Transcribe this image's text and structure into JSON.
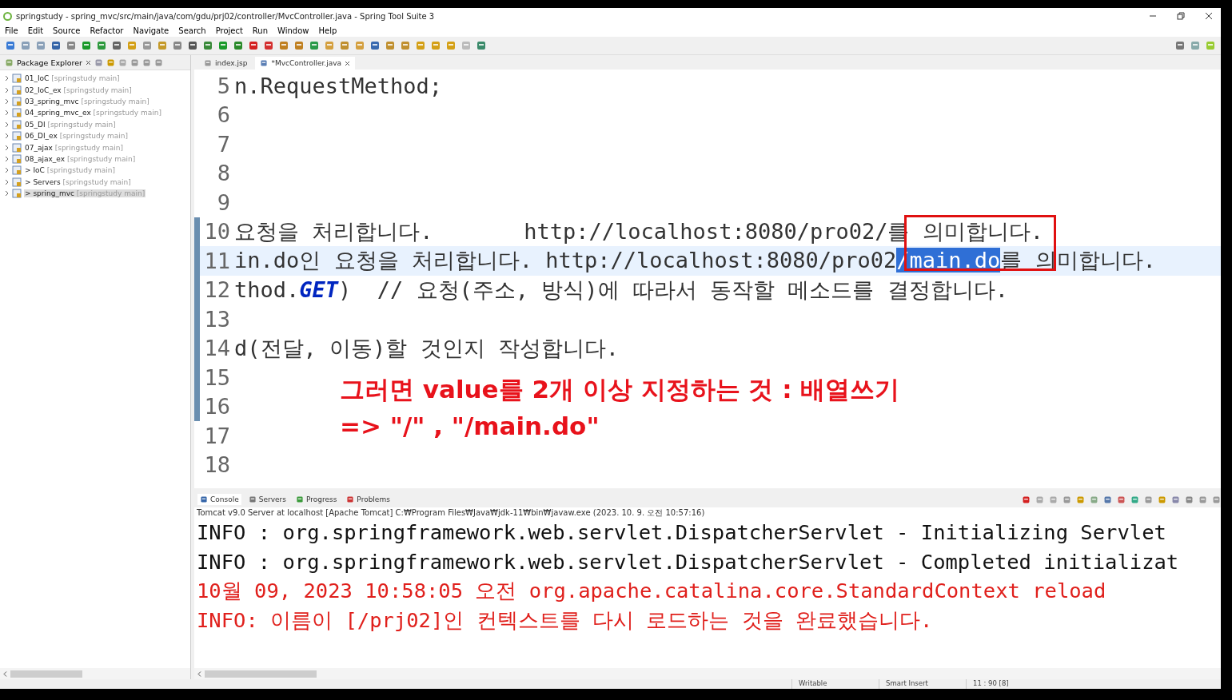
{
  "window": {
    "title": "springstudy - spring_mvc/src/main/java/com/gdu/prj02/controller/MvcController.java - Spring Tool Suite 3"
  },
  "menu": [
    "File",
    "Edit",
    "Source",
    "Refactor",
    "Navigate",
    "Search",
    "Project",
    "Run",
    "Window",
    "Help"
  ],
  "package_explorer": {
    "title": "Package Explorer",
    "items": [
      {
        "name": "01_IoC",
        "location": "[springstudy main]",
        "marker": "",
        "selected": false
      },
      {
        "name": "02_IoC_ex",
        "location": "[springstudy main]",
        "marker": "",
        "selected": false
      },
      {
        "name": "03_spring_mvc",
        "location": "[springstudy main]",
        "marker": "",
        "selected": false
      },
      {
        "name": "04_spring_mvc_ex",
        "location": "[springstudy main]",
        "marker": "",
        "selected": false
      },
      {
        "name": "05_DI",
        "location": "[springstudy main]",
        "marker": "",
        "selected": false
      },
      {
        "name": "06_DI_ex",
        "location": "[springstudy main]",
        "marker": "",
        "selected": false
      },
      {
        "name": "07_ajax",
        "location": "[springstudy main]",
        "marker": "",
        "selected": false
      },
      {
        "name": "08_ajax_ex",
        "location": "[springstudy main]",
        "marker": "",
        "selected": false
      },
      {
        "name": "IoC",
        "location": "[springstudy main]",
        "marker": ">",
        "selected": false
      },
      {
        "name": "Servers",
        "location": "[springstudy main]",
        "marker": ">",
        "selected": false
      },
      {
        "name": "spring_mvc",
        "location": "[springstudy main]",
        "marker": ">",
        "selected": true
      }
    ]
  },
  "editor": {
    "tabs": [
      {
        "label": "index.jsp",
        "selected": false
      },
      {
        "label": "*MvcController.java",
        "selected": true
      }
    ],
    "lines": [
      {
        "number": "5",
        "current": false,
        "changed": false,
        "segments": [
          {
            "text": "n.RequestMethod;",
            "kind": "plain"
          }
        ]
      },
      {
        "number": "6",
        "current": false,
        "changed": false
      },
      {
        "number": "7",
        "current": false,
        "changed": false
      },
      {
        "number": "8",
        "current": false,
        "changed": false
      },
      {
        "number": "9",
        "current": false,
        "changed": false
      },
      {
        "number": "10",
        "current": false,
        "changed": true,
        "segments": [
          {
            "text": "요청을 처리합니다.       http://localhost:8080/pro02/를 의미합니다.",
            "kind": "plain"
          }
        ]
      },
      {
        "number": "11",
        "current": true,
        "changed": true,
        "segments": [
          {
            "text": "in.do인 요청을 처리합니다. http://localhost:8080/pro02",
            "kind": "plain"
          },
          {
            "text": "/main.do",
            "kind": "selected"
          },
          {
            "text": "를 의미합니다.",
            "kind": "plain"
          }
        ]
      },
      {
        "number": "12",
        "current": false,
        "changed": true,
        "segments": [
          {
            "text": "thod.",
            "kind": "plain"
          },
          {
            "text": "GET",
            "kind": "constant"
          },
          {
            "text": ")  // 요청(주소, 방식)에 따라서 동작할 메소드를 결정합니다.",
            "kind": "plain"
          }
        ]
      },
      {
        "number": "13",
        "current": false,
        "changed": true
      },
      {
        "number": "14",
        "current": false,
        "changed": true,
        "segments": [
          {
            "text": "d(전달, 이동)할 것인지 작성합니다.",
            "kind": "plain"
          }
        ]
      },
      {
        "number": "15",
        "current": false,
        "changed": true
      },
      {
        "number": "16",
        "current": false,
        "changed": true
      },
      {
        "number": "17",
        "current": false,
        "changed": false
      },
      {
        "number": "18",
        "current": false,
        "changed": false
      }
    ],
    "annotation": {
      "color": "#e8121b",
      "lines": [
        "그러면 value를 2개 이상 지정하는 것 : 배열쓰기",
        "=> \"/\" , \"/main.do\""
      ]
    }
  },
  "console": {
    "tabs": [
      {
        "label": "Console",
        "selected": true
      },
      {
        "label": "Servers",
        "selected": false
      },
      {
        "label": "Progress",
        "selected": false
      },
      {
        "label": "Problems",
        "selected": false
      }
    ],
    "process": "Tomcat v9.0 Server at localhost [Apache Tomcat] C:₩Program Files₩Java₩jdk-11₩bin₩javaw.exe  (2023. 10. 9. 오전 10:57:16)",
    "lines": [
      {
        "text": "INFO : org.springframework.web.servlet.DispatcherServlet - Initializing Servlet",
        "kind": "stdout"
      },
      {
        "text": "INFO : org.springframework.web.servlet.DispatcherServlet - Completed initializat",
        "kind": "stdout"
      },
      {
        "text": "10월 09, 2023 10:58:05 오전 org.apache.catalina.core.StandardContext reload",
        "kind": "stderr"
      },
      {
        "text": "INFO: 이름이 [/prj02]인 컨텍스트를 다시 로드하는 것을 완료했습니다.",
        "kind": "stderr"
      }
    ]
  },
  "status_bar": [
    "Writable",
    "Smart Insert",
    "11 : 90 [8]"
  ]
}
